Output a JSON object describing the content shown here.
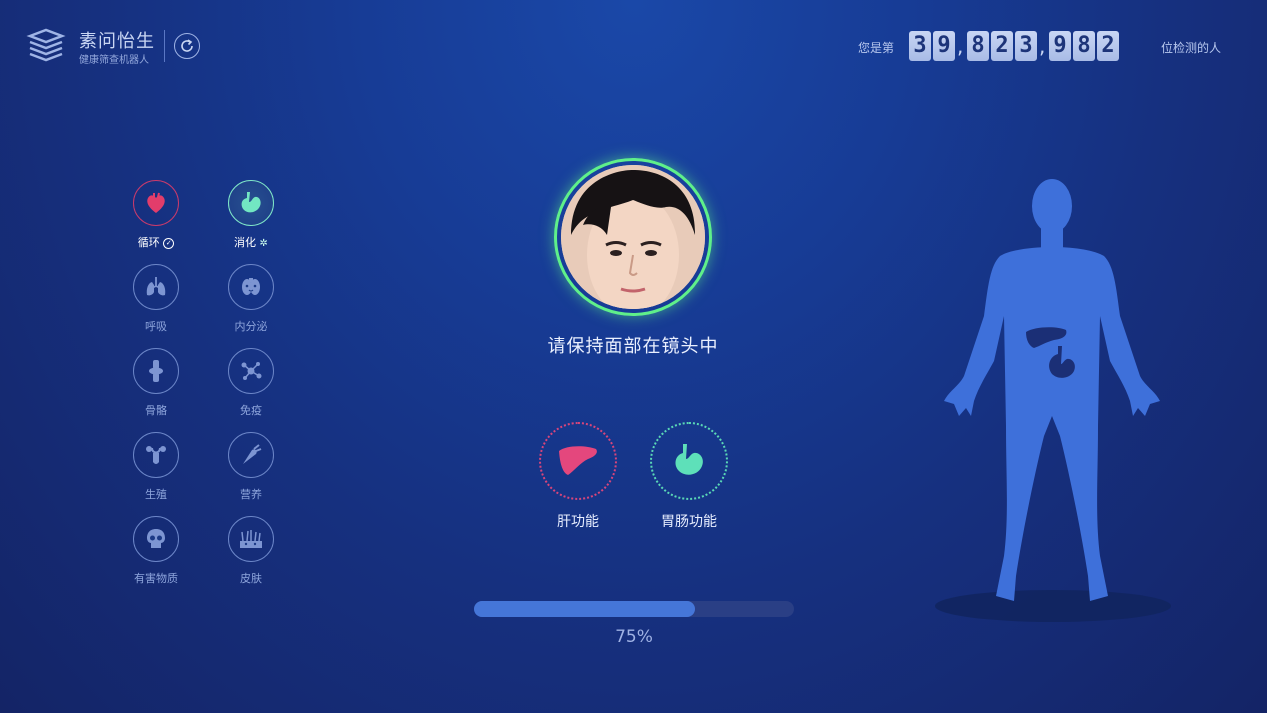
{
  "brand": {
    "title": "素问怡生",
    "subtitle": "健康筛查机器人"
  },
  "counter": {
    "prefix": "您是第",
    "digits": [
      "3",
      "9",
      ",",
      "8",
      "2",
      "3",
      ",",
      "9",
      "8",
      "2"
    ],
    "suffix": "位检测的人"
  },
  "systems": [
    {
      "label": "循环",
      "status_icon": "check-circle-icon",
      "icon": "heart-icon",
      "state": "done"
    },
    {
      "label": "消化",
      "status_icon": "loading-spinner-icon",
      "icon": "stomach-icon",
      "state": "active"
    },
    {
      "label": "呼吸",
      "icon": "lungs-icon",
      "state": "pending"
    },
    {
      "label": "内分泌",
      "icon": "endocrine-icon",
      "state": "pending"
    },
    {
      "label": "骨骼",
      "icon": "bone-joint-icon",
      "state": "pending"
    },
    {
      "label": "免疫",
      "icon": "molecule-icon",
      "state": "pending"
    },
    {
      "label": "生殖",
      "icon": "reproductive-icon",
      "state": "pending"
    },
    {
      "label": "营养",
      "icon": "carrot-icon",
      "state": "pending"
    },
    {
      "label": "有害物质",
      "icon": "skull-icon",
      "state": "pending"
    },
    {
      "label": "皮肤",
      "icon": "skin-hair-icon",
      "state": "pending"
    }
  ],
  "face": {
    "instruction": "请保持面部在镜头中"
  },
  "functions": [
    {
      "label": "肝功能",
      "icon": "liver-icon"
    },
    {
      "label": "胃肠功能",
      "icon": "stomach-icon"
    }
  ],
  "progress": {
    "value": 0.69,
    "text": "75%"
  },
  "colors": {
    "accent_green": "#5ff08a",
    "liver_red": "#d8457b",
    "stomach_teal": "#5ad8b6",
    "body_blue": "#3d6fd8",
    "progress_blue": "#4576d8"
  }
}
